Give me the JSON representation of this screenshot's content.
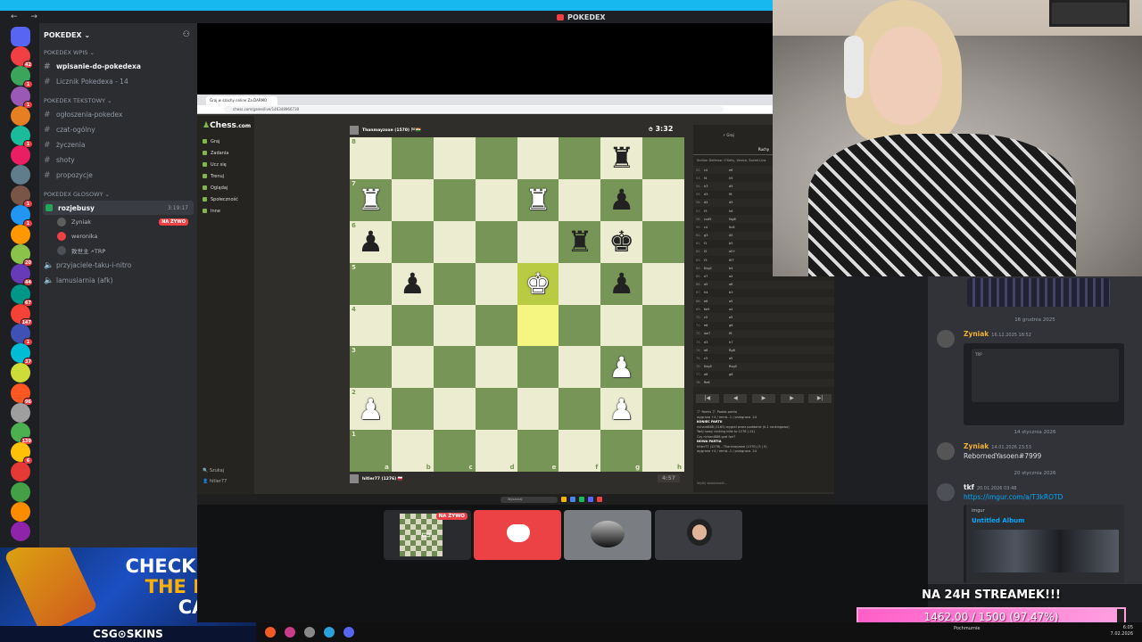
{
  "window": {
    "title": "POKEDEX",
    "nav": "←  →"
  },
  "server": {
    "name": "POKEDEX"
  },
  "rail_badges": [
    "",
    "42",
    "1",
    "1",
    "",
    "1",
    "",
    "",
    "1",
    "1",
    "",
    "20",
    "44",
    "67",
    "147",
    "1",
    "37",
    "",
    "96",
    "",
    "139",
    "6",
    "",
    "",
    "",
    ""
  ],
  "categories": {
    "wpis": "POKEDEX Wpis",
    "tekstowy": "POKEDEX Tekstowy",
    "glosowy": "POKEDEX GŁOSOWY"
  },
  "channels_wpis": [
    "wpisanie-do-pokedexa",
    "Licznik Pokedexa - 14"
  ],
  "channels_text": [
    "ogłoszenia-pokedex",
    "czat-ogólny",
    "życzenia",
    "shoty",
    "propozycje"
  ],
  "voice": {
    "name": "rozjebusy",
    "time": "3:19:17",
    "users": [
      {
        "name": "Zyniak",
        "live": "NA ŻYWO"
      },
      {
        "name": "weronika",
        "live": ""
      },
      {
        "name": "致世主 🗲TRP",
        "live": ""
      }
    ]
  },
  "channels_voice_other": [
    "przyjaciele-taku-i-nitro",
    "lamusiarnia (afk)"
  ],
  "ad": {
    "line1": "CHECK OUT",
    "line2": "THE BEST",
    "line3": "CASES",
    "brand": "CSG⊙SKINS"
  },
  "browser": {
    "tab": "Graj w szachy online Za DARMO",
    "url": "chess.com/game/live/146348966730"
  },
  "chess": {
    "logo_a": "Chess",
    "logo_b": ".com",
    "nav": [
      "Graj",
      "Zadania",
      "Ucz się",
      "Trenuj",
      "Oglądaj",
      "Społeczność",
      "Inne"
    ],
    "bottom": [
      "Szukaj",
      "hitler77"
    ],
    "top_player": "Thanmayzoxe (1570) 🏁🇮🇳",
    "bottom_player": "hitler77 (1276) 🇵🇱",
    "top_clock": "3:32",
    "bottom_clock": "4:57",
    "ranks": [
      "8",
      "7",
      "6",
      "5",
      "4",
      "3",
      "2",
      "1"
    ],
    "files": [
      "a",
      "b",
      "c",
      "d",
      "e",
      "f",
      "g",
      "h"
    ],
    "board": [
      [
        "",
        "",
        "",
        "",
        "",
        "",
        "br",
        ""
      ],
      [
        "wr",
        "",
        "",
        "",
        "wr",
        "",
        "bp",
        ""
      ],
      [
        "bp",
        "",
        "",
        "",
        "",
        "br",
        "bk",
        ""
      ],
      [
        "",
        "bp",
        "",
        "",
        "wk",
        "",
        "bp",
        ""
      ],
      [
        "",
        "",
        "",
        "",
        "",
        "",
        "",
        ""
      ],
      [
        "",
        "",
        "",
        "",
        "",
        "",
        "wp",
        ""
      ],
      [
        "wp",
        "",
        "",
        "",
        "",
        "",
        "wp",
        ""
      ],
      [
        "",
        "",
        "",
        "",
        "",
        "",
        "",
        ""
      ]
    ],
    "highlight": [
      [
        3,
        4
      ],
      [
        4,
        4
      ]
    ],
    "panel_tabs": [
      "Graj",
      "Nowa partia"
    ],
    "moves_tab": "Ruchy",
    "opening": "Sicilian Defense: O'Kelly, Venice, Soviet Line",
    "moves": [
      [
        "52.",
        "c4",
        "e6"
      ],
      [
        "53.",
        "f4",
        "h5"
      ],
      [
        "54.",
        "h3",
        "d5"
      ],
      [
        "55.",
        "d3",
        "f6"
      ],
      [
        "56.",
        "d4",
        "d5"
      ],
      [
        "57.",
        "f3",
        "h6"
      ],
      [
        "58.",
        "cxd5",
        "fxg6"
      ],
      [
        "59.",
        "c4",
        "Kc8"
      ],
      [
        "60.",
        "g3",
        "d5"
      ],
      [
        "61.",
        "f1",
        "b5"
      ],
      [
        "62.",
        "f2",
        "a5+"
      ],
      [
        "63.",
        "f3",
        "Kf7"
      ],
      [
        "64.",
        "Kxg2",
        "b4"
      ],
      [
        "65.",
        "e7",
        "a4"
      ],
      [
        "66.",
        "a5",
        "a6"
      ],
      [
        "67.",
        "h4",
        "b3"
      ],
      [
        "68.",
        "e6",
        "a5"
      ],
      [
        "69.",
        "Ke5",
        "a4"
      ],
      [
        "70.",
        "c5",
        "a5"
      ],
      [
        "71.",
        "e6",
        "g6"
      ],
      [
        "72.",
        "we7",
        "f6"
      ],
      [
        "73.",
        "d3",
        "h7"
      ],
      [
        "74.",
        "a6",
        "Rg6"
      ],
      [
        "75.",
        "c3",
        "a5"
      ],
      [
        "76.",
        "Kxg5",
        "Rxg5"
      ],
      [
        "77.",
        "a6",
        "g6"
      ],
      [
        "78.",
        "Re6",
        ""
      ]
    ],
    "controls": [
      "|◀",
      "◀",
      "▶",
      "▶",
      "▶|"
    ],
    "log": [
      "🏳 Remis   🏳 Podda partię",
      "wygrana +4 / remis -1 / przegrana -14",
      "KONIEC PARTII",
      "richard888 (1163) wygrał przez poddanie (0-1 rankingowa)",
      "Twój nowy ranking blitz to 1276 (-14)",
      "Czy richard888 grał fair?",
      "NOWA PARTIA",
      "hitler77 (1276) - Thanmayzoxe (1570) (3 | 0)",
      "wygrana +4 / remis -1 / przegrana -14"
    ],
    "chat_placeholder": "Wyślij wiadomość...",
    "win_search": "Wyszukaj"
  },
  "chat": {
    "date1": "16 grudnia 2025",
    "msg1_author": "Zyniak",
    "msg1_ts": "16.12.2025 18:52",
    "date2": "14 stycznia 2026",
    "msg2_author": "Zyniak",
    "msg2_ts": "14.01.2026 23:53",
    "msg2_text": "RebornedYasoen#7999",
    "date3": "20 stycznia 2026",
    "msg3_author": "tkf",
    "msg3_ts": "20.01.2026 03:48",
    "msg3_link": "https://imgur.com/a/T3kROTD",
    "embed_site": "imgur",
    "embed_title": "Untitled Album",
    "embed_card_title": "TRP"
  },
  "goal": {
    "label": "NA 24H STREAMEK!!!",
    "text": "1462.00 / 1500 (97.47%)",
    "percent": 97.47
  },
  "stage": {
    "live": "NA ŻYWO"
  },
  "taskbar": {
    "weather": "Pochmurnie",
    "time": "6:05",
    "date": "7.02.2026"
  },
  "colors": {
    "accent": "#5865f2",
    "live": "#ed4245",
    "voice": "#23a55a",
    "link": "#00a8fc",
    "goal": "#ff5fc7"
  }
}
